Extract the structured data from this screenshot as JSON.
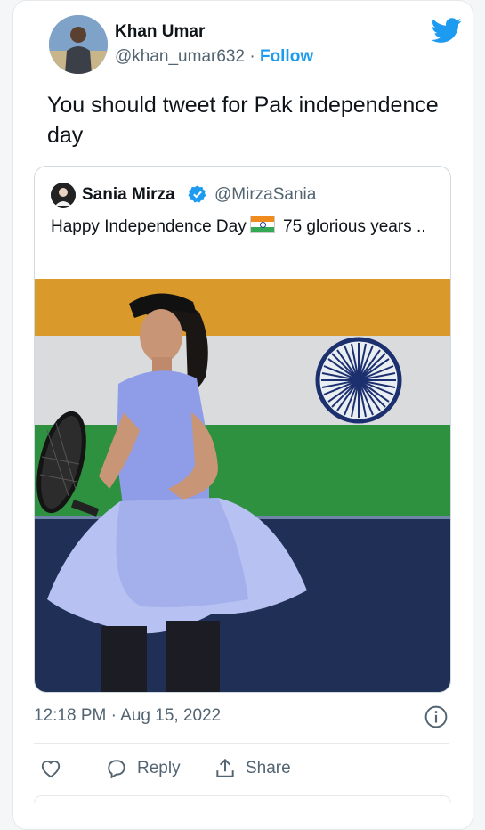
{
  "tweet": {
    "author_name": "Khan Umar",
    "author_handle": "@khan_umar632",
    "separator": "·",
    "follow_label": "Follow",
    "text": "You should tweet for Pak independence day",
    "timestamp": "12:18 PM · Aug 15, 2022"
  },
  "quoted_tweet": {
    "author_name": "Sania Mirza",
    "author_handle": "@MirzaSania",
    "text_before_flag": "Happy Independence Day",
    "flag_emoji": "🇮🇳",
    "text_after_flag": "75 glorious years .."
  },
  "actions": {
    "like_icon": "heart-icon",
    "reply_label": "Reply",
    "share_label": "Share"
  },
  "icons": [
    "twitter-bird-icon",
    "verified-badge-icon",
    "info-icon",
    "reply-bubble-icon",
    "share-icon"
  ],
  "colors": {
    "brand_blue": "#1d9bf0",
    "text_primary": "#0f1419",
    "text_secondary": "#536471",
    "flag_saffron": "#e59a2e",
    "flag_green": "#2f9a3a",
    "chakra_blue": "#1c2f6e"
  }
}
